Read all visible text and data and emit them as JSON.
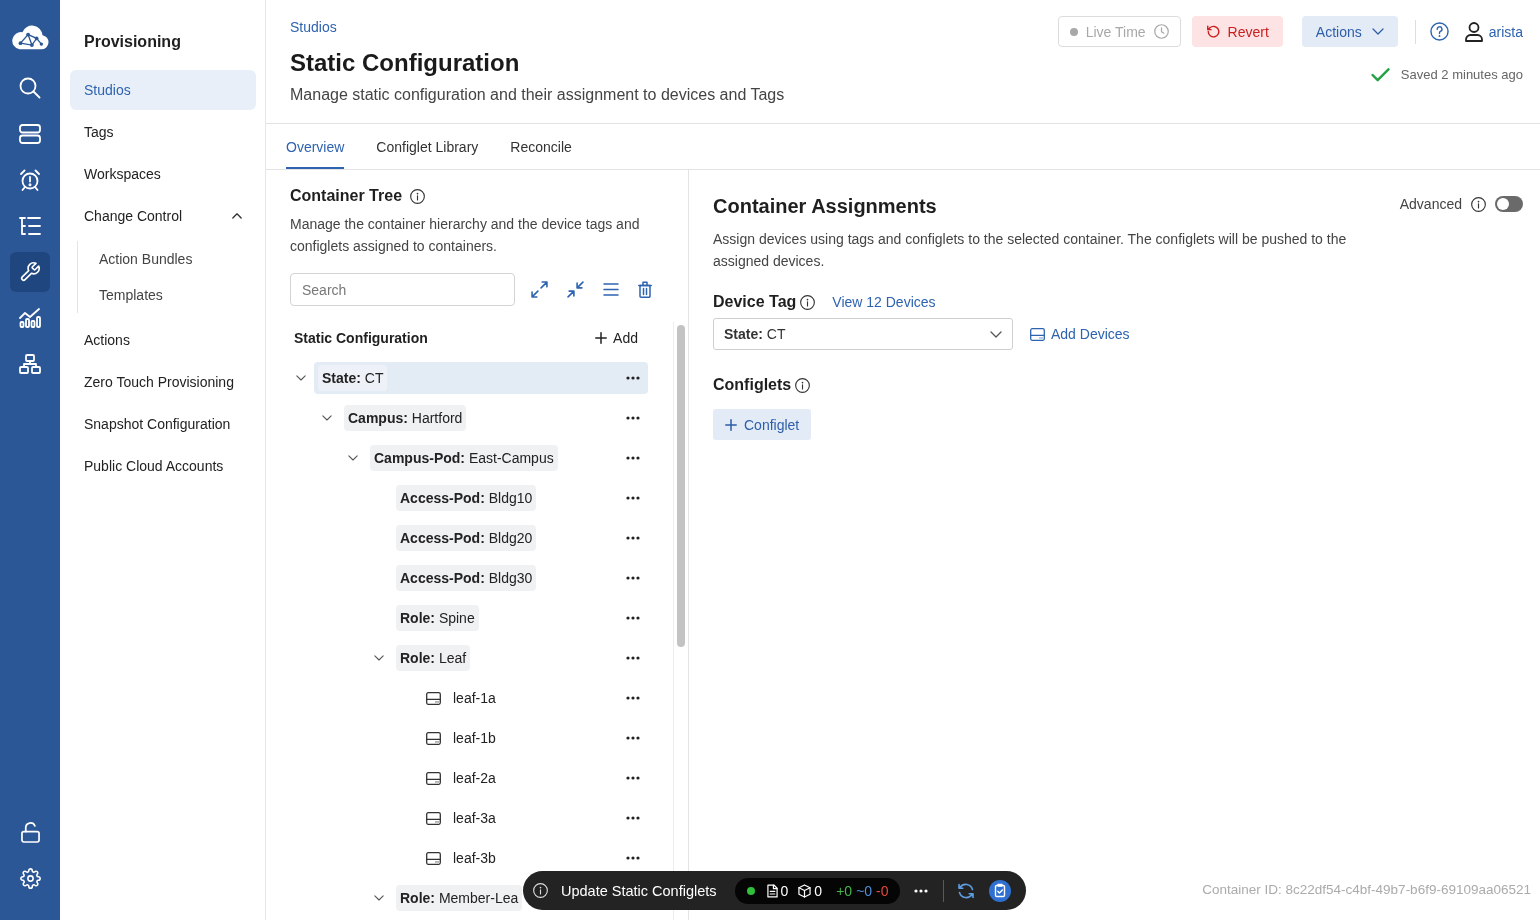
{
  "nav_rail": [
    {
      "selected": false
    },
    {
      "selected": false
    },
    {
      "selected": false
    },
    {
      "selected": false
    },
    {
      "selected": true
    },
    {
      "selected": false
    },
    {
      "selected": false
    }
  ],
  "sidebar": {
    "title": "Provisioning",
    "items": [
      {
        "label": "Studios",
        "selected": true
      },
      {
        "label": "Tags",
        "selected": false
      },
      {
        "label": "Workspaces",
        "selected": false
      },
      {
        "label": "Change Control",
        "selected": false,
        "expanded": true,
        "children": [
          {
            "label": "Action Bundles",
            "selected": false
          },
          {
            "label": "Templates",
            "selected": false
          }
        ]
      },
      {
        "label": "Actions",
        "selected": false
      },
      {
        "label": "Zero Touch Provisioning",
        "selected": false
      },
      {
        "label": "Snapshot Configuration",
        "selected": false
      },
      {
        "label": "Public Cloud Accounts",
        "selected": false
      }
    ]
  },
  "header": {
    "breadcrumb": "Studios",
    "title": "Static Configuration",
    "subtitle": "Manage static configuration and their assignment to devices and Tags",
    "buttons": [
      {
        "kind": "live",
        "label": "Live Time",
        "disabled": true
      },
      {
        "kind": "danger",
        "label": "Revert",
        "disabled": false
      },
      {
        "kind": "menu",
        "label": "Actions",
        "disabled": false
      }
    ],
    "user": "arista",
    "save_status": "Saved 2 minutes ago"
  },
  "tabs": [
    {
      "label": "Overview",
      "selected": true
    },
    {
      "label": "Configlet Library",
      "selected": false
    },
    {
      "label": "Reconcile",
      "selected": false
    }
  ],
  "container_tree": {
    "title": "Container Tree",
    "description": "Manage the container hierarchy and the device tags and configlets assigned to containers.",
    "search": {
      "placeholder": "Search"
    },
    "root": {
      "label": "Static Configuration",
      "add_label": "Add"
    },
    "nodes": [
      {
        "kind": "container",
        "label": "**State:** CT",
        "selected": true,
        "expanded": true,
        "children": [
          {
            "kind": "container",
            "label": "**Campus:** Hartford",
            "selected": false,
            "expanded": true,
            "children": [
              {
                "kind": "container",
                "label": "**Campus-Pod:** East-Campus",
                "selected": false,
                "expanded": true,
                "children": [
                  {
                    "kind": "container",
                    "label": "**Access-Pod:** Bldg10",
                    "selected": false
                  },
                  {
                    "kind": "container",
                    "label": "**Access-Pod:** Bldg20",
                    "selected": false
                  },
                  {
                    "kind": "container",
                    "label": "**Access-Pod:** Bldg30",
                    "selected": false
                  },
                  {
                    "kind": "container",
                    "label": "**Role:** Spine",
                    "selected": false
                  },
                  {
                    "kind": "container",
                    "label": "**Role:** Leaf",
                    "selected": false,
                    "expanded": true,
                    "children": [
                      {
                        "kind": "device",
                        "label": "leaf-1a",
                        "selected": false
                      },
                      {
                        "kind": "device",
                        "label": "leaf-1b",
                        "selected": false
                      },
                      {
                        "kind": "device",
                        "label": "leaf-2a",
                        "selected": false
                      },
                      {
                        "kind": "device",
                        "label": "leaf-3a",
                        "selected": false
                      },
                      {
                        "kind": "device",
                        "label": "leaf-3b",
                        "selected": false
                      }
                    ]
                  },
                  {
                    "kind": "container",
                    "label": "**Role:** Member-Lea",
                    "selected": false,
                    "expanded": true
                  }
                ]
              }
            ]
          }
        ]
      }
    ]
  },
  "container_assignments": {
    "title": "Container Assignments",
    "advanced": {
      "label": "Advanced",
      "on": false
    },
    "description": "Assign devices using tags and configlets to the selected container. The configlets will be pushed to the assigned devices.",
    "device_tag": {
      "label": "Device Tag",
      "link": "View 12 Devices",
      "value": "**State:** CT",
      "add_label": "Add Devices"
    },
    "configlets": {
      "label": "Configlets",
      "add_label": "Configlet"
    },
    "container_id": "Container ID: 8c22df54-c4bf-49b7-b6f9-69109aa06521"
  },
  "change_bar": {
    "message": "Update Static Configlets",
    "files": "0",
    "devices": "0",
    "added": "+0",
    "modified": "~0",
    "removed": "-0"
  }
}
